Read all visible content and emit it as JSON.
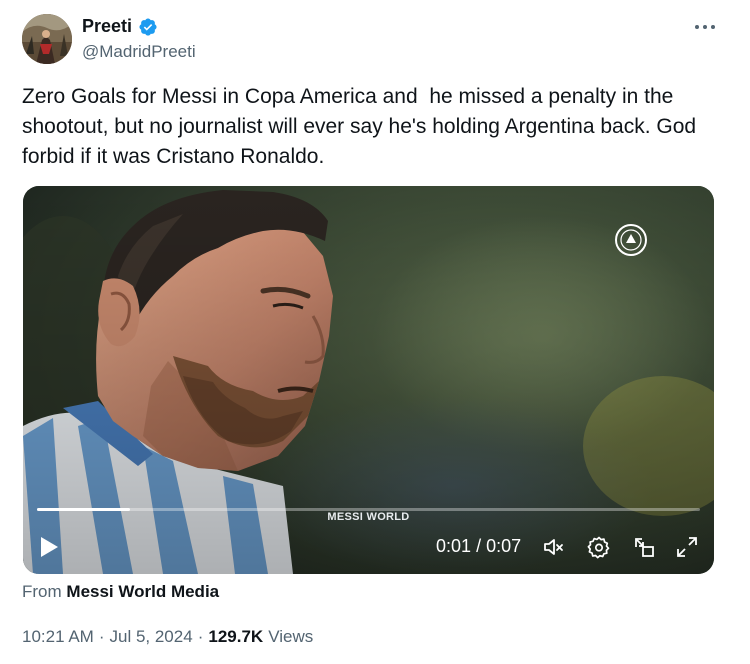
{
  "author": {
    "display_name": "Preeti",
    "handle": "@MadridPreeti",
    "verified": true
  },
  "tweet": {
    "text": "Zero Goals for Messi in Copa America and  he missed a penalty in the shootout, but no journalist will ever say he's holding Argentina back. God forbid if it was Cristano Ronaldo."
  },
  "video": {
    "caption": "MESSI WORLD",
    "current_time": "0:01",
    "separator": "/",
    "duration": "0:07",
    "progress_fraction": 0.14
  },
  "source": {
    "prefix": "From",
    "name": "Messi World Media"
  },
  "meta": {
    "time": "10:21 AM",
    "date": "Jul 5, 2024",
    "views_count": "129.7K",
    "views_label": "Views",
    "dot": "·"
  },
  "colors": {
    "text_primary": "#0f1419",
    "text_secondary": "#536471",
    "verified_blue": "#1d9bf0"
  },
  "icons": {
    "verified": "verified-badge-icon",
    "more": "more-options-icon",
    "play": "play-icon",
    "mute": "mute-icon",
    "settings": "gear-icon",
    "pip": "picture-in-picture-icon",
    "fullscreen": "fullscreen-icon"
  }
}
